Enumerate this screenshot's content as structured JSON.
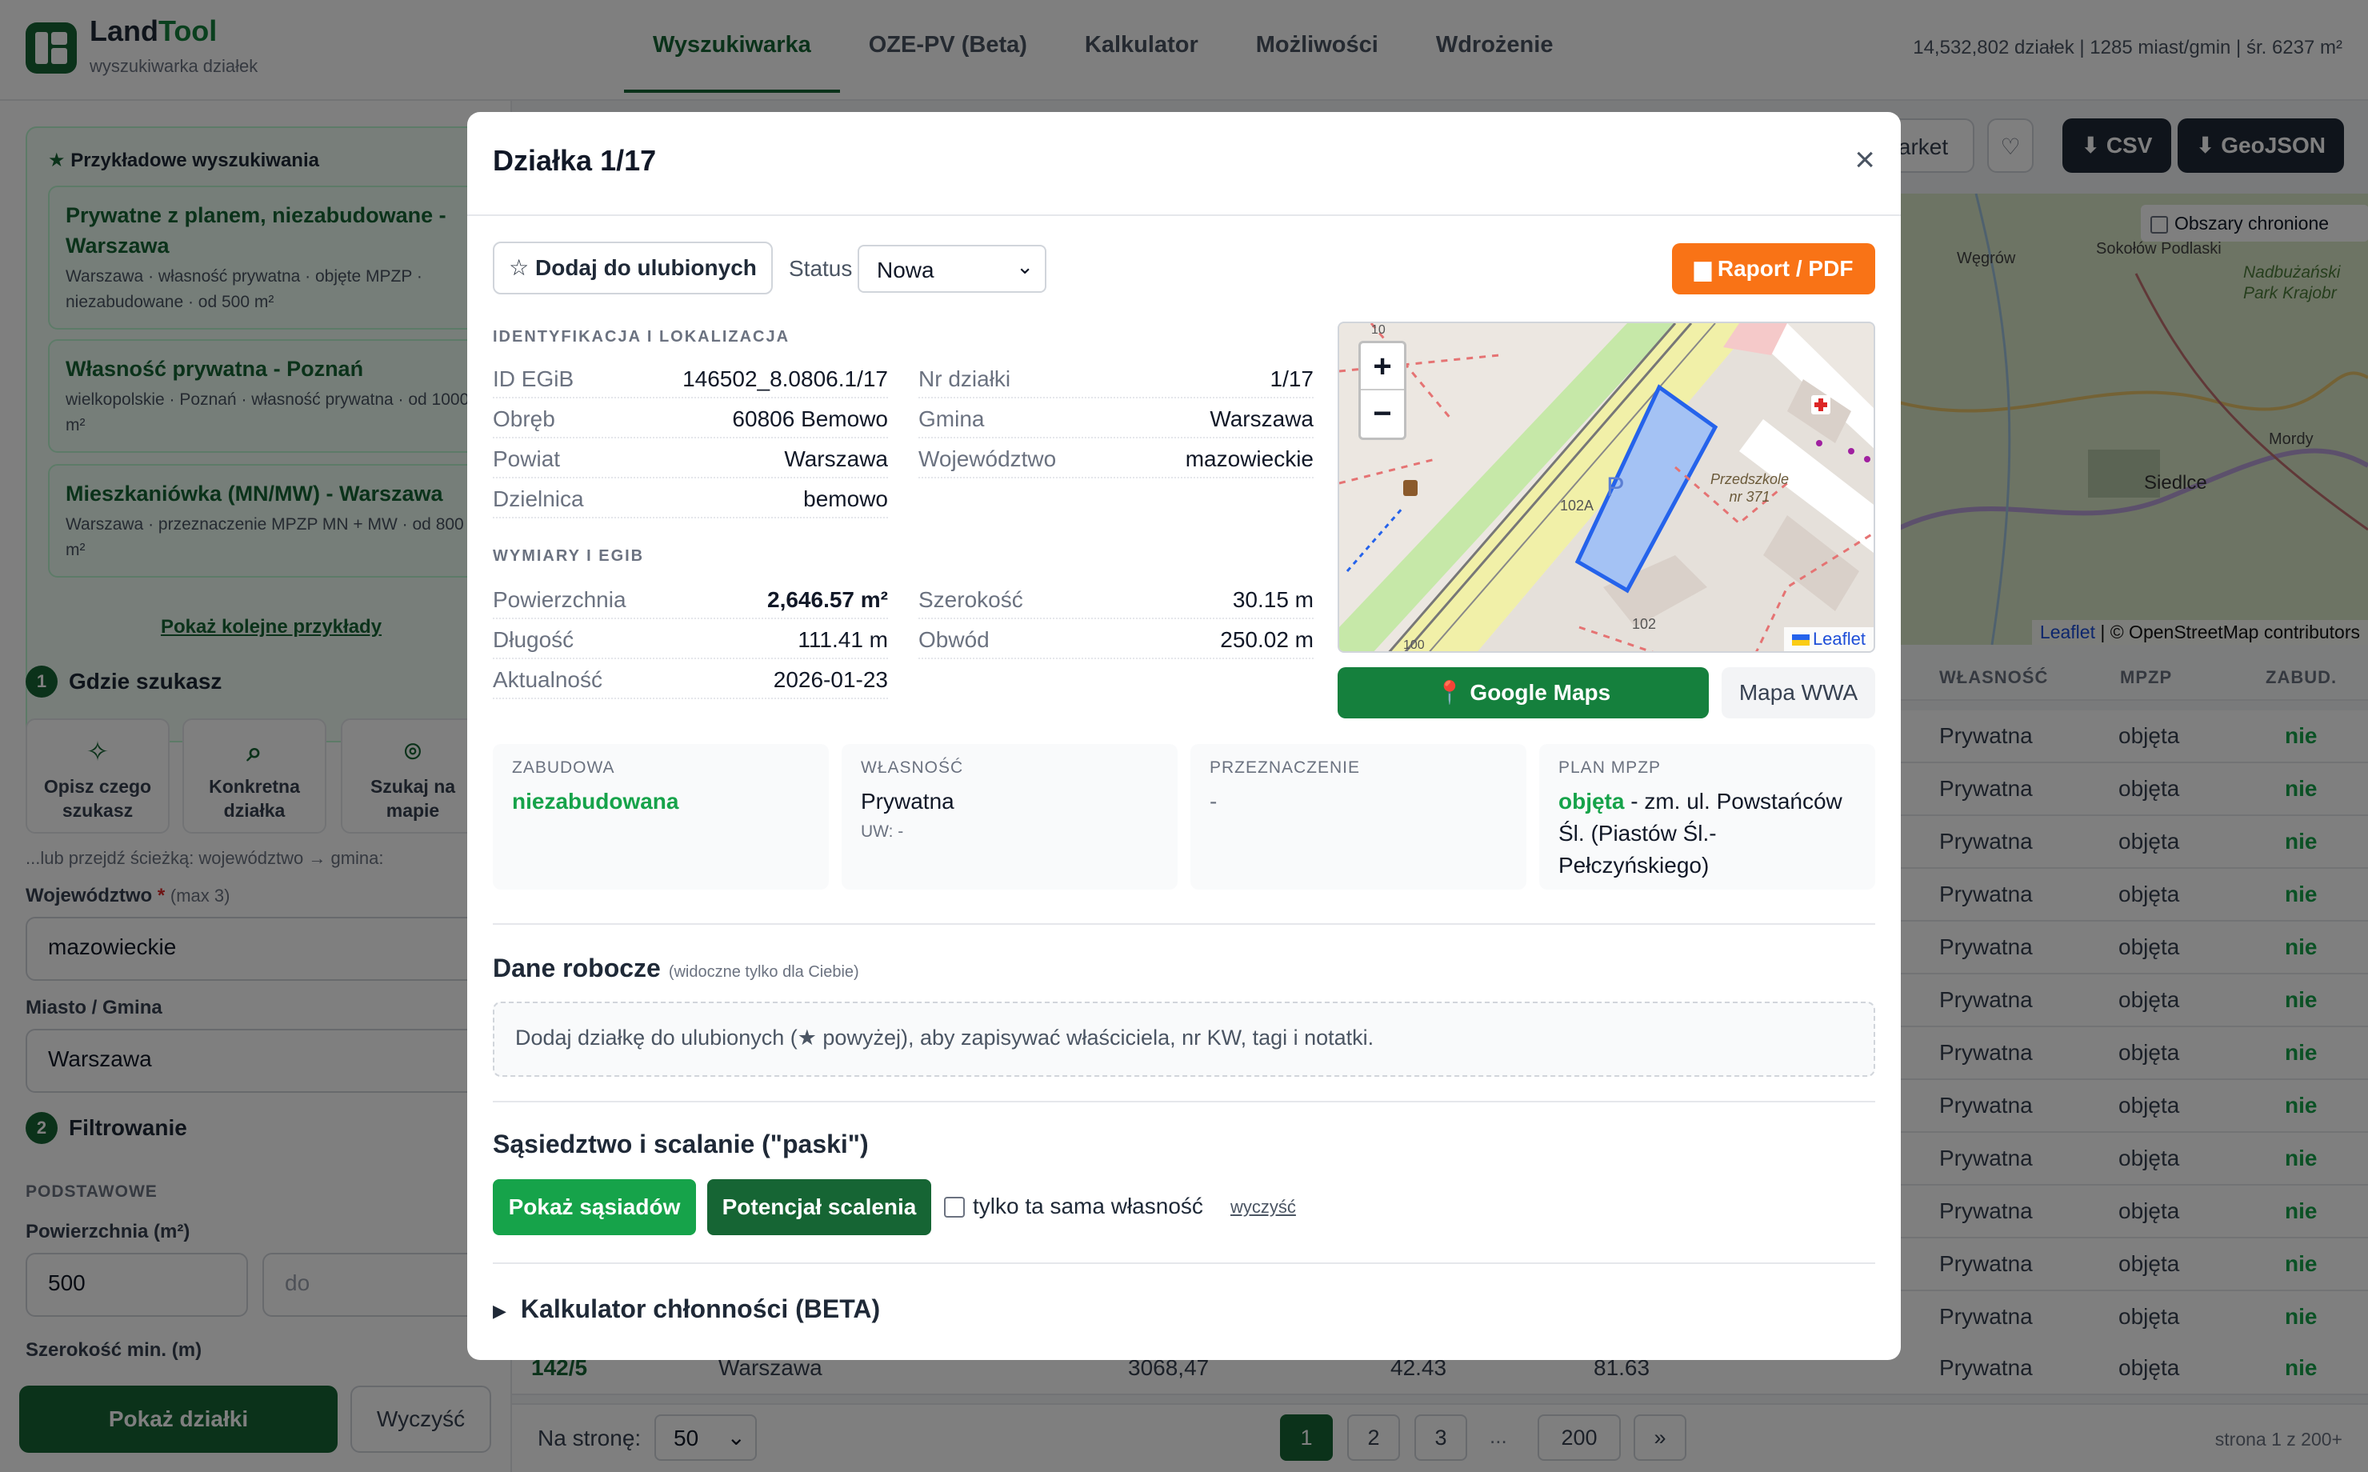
{
  "app": {
    "name_part1": "Land",
    "name_part2": "Tool",
    "subtitle": "wyszukiwarka działek"
  },
  "nav": {
    "tabs": [
      "Wyszukiwarka",
      "OZE-PV (Beta)",
      "Kalkulator",
      "Możliwości",
      "Wdrożenie"
    ],
    "active": "Wyszukiwarka"
  },
  "stats": "14,532,802 działek | 1285 miast/gmin | śr. 6237 m²",
  "sidebar": {
    "examples_heading": "Przykładowe wyszukiwania",
    "examples": [
      {
        "title": "Prywatne z planem, niezabudowane - Warszawa",
        "desc": "Warszawa · własność prywatna · objęte MPZP · niezabudowane · od 500 m²"
      },
      {
        "title": "Własność prywatna - Poznań",
        "desc": "wielkopolskie · Poznań · własność prywatna · od 1000 m²"
      },
      {
        "title": "Mieszkaniówka (MN/MW) - Warszawa",
        "desc": "Warszawa · przeznaczenie MPZP MN + MW · od 800 m²"
      }
    ],
    "more_examples": "Pokaż kolejne przykłady",
    "step1": {
      "num": "1",
      "title": "Gdzie szukasz"
    },
    "modes": [
      "Opisz czego szukasz",
      "Konkretna działka",
      "Szukaj na mapie"
    ],
    "path_note": "...lub przejdź ścieżką: województwo → gmina:",
    "voivodeship_label": "Województwo",
    "voivodeship_req": "*",
    "voivodeship_hint": "(max 3)",
    "voivodeship_value": "mazowieckie",
    "city_label": "Miasto / Gmina",
    "city_value": "Warszawa",
    "step2": {
      "num": "2",
      "title": "Filtrowanie"
    },
    "basic_head": "PODSTAWOWE",
    "area_label": "Powierzchnia (m²)",
    "area_min": "500",
    "area_max_placeholder": "do",
    "width_label": "Szerokość min. (m)",
    "show_button": "Pokaż działki",
    "clear_button": "Wyczyść"
  },
  "main": {
    "market_btn": "arket",
    "csv_btn": "CSV",
    "geojson_btn": "GeoJSON",
    "protected_areas": "Obszary chronione",
    "map_attribution_leaflet": "Leaflet",
    "map_attribution_osm": "| © OpenStreetMap contributors",
    "map_places": [
      "Węgrów",
      "Sokołów Podlaski",
      "Nadbużański Park Krajobr",
      "Mordy",
      "Siedlce"
    ],
    "table_headers": [
      "WŁASNOŚĆ",
      "MPZP",
      "ZABUD."
    ],
    "rows": [
      {
        "ownership": "Prywatna",
        "mpzp": "objęta",
        "built": "nie"
      },
      {
        "ownership": "Prywatna",
        "mpzp": "objęta",
        "built": "nie"
      },
      {
        "ownership": "Prywatna",
        "mpzp": "objęta",
        "built": "nie"
      },
      {
        "ownership": "Prywatna",
        "mpzp": "objęta",
        "built": "nie"
      },
      {
        "ownership": "Prywatna",
        "mpzp": "objęta",
        "built": "nie"
      },
      {
        "ownership": "Prywatna",
        "mpzp": "objęta",
        "built": "nie"
      },
      {
        "ownership": "Prywatna",
        "mpzp": "objęta",
        "built": "nie"
      },
      {
        "ownership": "Prywatna",
        "mpzp": "objęta",
        "built": "nie"
      },
      {
        "ownership": "Prywatna",
        "mpzp": "objęta",
        "built": "nie"
      },
      {
        "ownership": "Prywatna",
        "mpzp": "objęta",
        "built": "nie"
      },
      {
        "ownership": "Prywatna",
        "mpzp": "objęta",
        "built": "nie"
      },
      {
        "ownership": "Prywatna",
        "mpzp": "objęta",
        "built": "nie"
      }
    ],
    "last_row": {
      "id": "142/5",
      "city": "Warszawa",
      "area": "3068,47",
      "width": "42.43",
      "length": "81.63",
      "ownership": "Prywatna",
      "mpzp": "objęta",
      "built": "nie"
    },
    "per_page_label": "Na stronę:",
    "per_page_value": "50",
    "pages": [
      "1",
      "2",
      "3",
      "...",
      "200",
      "»"
    ],
    "page_info": "strona 1 z 200+"
  },
  "modal": {
    "title": "Działka 1/17",
    "close": "×",
    "fav_button": "☆ Dodaj do ulubionych",
    "status_label": "Status",
    "status_value": "Nowa",
    "pdf_button": "Raport / PDF",
    "ident_head": "IDENTYFIKACJA I LOKALIZACJA",
    "ident": [
      {
        "k": "ID EGiB",
        "v": "146502_8.0806.1/17"
      },
      {
        "k": "Obręb",
        "v": "60806 Bemowo"
      },
      {
        "k": "Powiat",
        "v": "Warszawa"
      },
      {
        "k": "Dzielnica",
        "v": "bemowo"
      },
      {
        "k": "Nr działki",
        "v": "1/17"
      },
      {
        "k": "Gmina",
        "v": "Warszawa"
      },
      {
        "k": "Województwo",
        "v": "mazowieckie"
      }
    ],
    "dims_head": "WYMIARY I EGIB",
    "dims": [
      {
        "k": "Powierzchnia",
        "v": "2,646.57 m²"
      },
      {
        "k": "Długość",
        "v": "111.41 m"
      },
      {
        "k": "Aktualność",
        "v": "2026-01-23"
      },
      {
        "k": "Szerokość",
        "v": "30.15 m"
      },
      {
        "k": "Obwód",
        "v": "250.02 m"
      }
    ],
    "map": {
      "zoom_in": "+",
      "zoom_out": "−",
      "attribution": "Leaflet",
      "labels": [
        "Przedszkole",
        "nr 371",
        "102A",
        "102",
        "P",
        "10",
        "100"
      ]
    },
    "gmaps_button": "Google Maps",
    "wwa_button": "Mapa WWA",
    "cards": [
      {
        "h": "ZABUDOWA",
        "v": "niezabudowana"
      },
      {
        "h": "WŁASNOŚĆ",
        "v": "Prywatna",
        "s": "UW: -"
      },
      {
        "h": "PRZEZNACZENIE",
        "v": "-"
      },
      {
        "h": "PLAN MPZP",
        "v_green": "objęta",
        "v": " - zm. ul. Powstańców Śl. (Piastów Śl.-Pełczyńskiego)"
      }
    ],
    "work_title": "Dane robocze",
    "work_note": "(widoczne tylko dla Ciebie)",
    "work_box": "Dodaj działkę do ulubionych (★ powyżej), aby zapisywać właściciela, nr KW, tagi i notatki.",
    "neigh_title": "Sąsiedztwo i scalanie (\"paski\")",
    "neigh_btn": "Pokaż sąsiadów",
    "merge_btn": "Potencjał scalenia",
    "same_owner": "tylko ta sama własność",
    "clear_link": "wyczyść",
    "calc_title": "Kalkulator chłonności (BETA)"
  },
  "colors": {
    "brand": "#166534",
    "orange": "#f97316",
    "green_text": "#16a34a"
  }
}
